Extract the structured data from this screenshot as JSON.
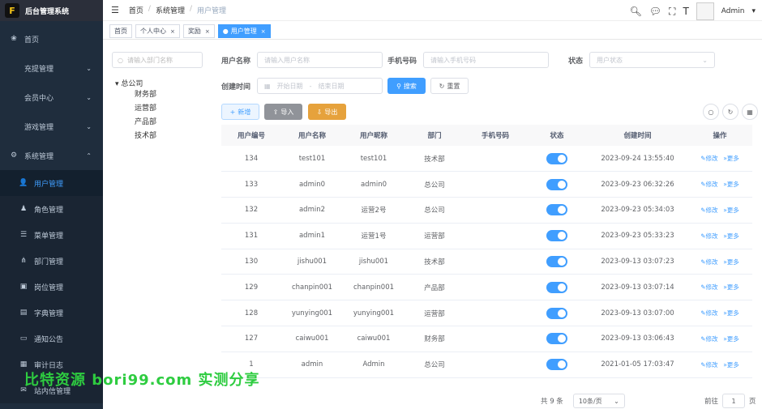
{
  "app": {
    "title": "后台管理系统",
    "logo_text": "F"
  },
  "sidebar": {
    "items": [
      {
        "label": "首页",
        "icon": "dashboard-icon"
      },
      {
        "label": "充提管理",
        "icon": ""
      },
      {
        "label": "会员中心",
        "icon": ""
      },
      {
        "label": "游戏管理",
        "icon": ""
      },
      {
        "label": "系统管理",
        "icon": "gear-icon"
      }
    ],
    "sub_items": [
      {
        "label": "用户管理",
        "icon": "user-icon",
        "active": true
      },
      {
        "label": "角色管理",
        "icon": "peoples-icon"
      },
      {
        "label": "菜单管理",
        "icon": "tree-table-icon"
      },
      {
        "label": "部门管理",
        "icon": "tree-icon"
      },
      {
        "label": "岗位管理",
        "icon": "post-icon"
      },
      {
        "label": "字典管理",
        "icon": "dict-icon"
      },
      {
        "label": "通知公告",
        "icon": "message-icon"
      },
      {
        "label": "审计日志",
        "icon": "log-icon"
      },
      {
        "label": "站内信管理",
        "icon": "mail-icon"
      }
    ]
  },
  "header": {
    "breadcrumb": [
      "首页",
      "系统管理",
      "用户管理"
    ],
    "username": "Admin"
  },
  "tags": [
    {
      "label": "首页",
      "closable": false,
      "active": false
    },
    {
      "label": "个人中心",
      "closable": true,
      "active": false
    },
    {
      "label": "奖励",
      "closable": true,
      "active": false
    },
    {
      "label": "用户管理",
      "closable": true,
      "active": true
    }
  ],
  "tree": {
    "search_placeholder": "请输入部门名称",
    "root": "总公司",
    "children": [
      "财务部",
      "运营部",
      "产品部",
      "技术部"
    ]
  },
  "form": {
    "username_label": "用户名称",
    "username_placeholder": "请输入用户名称",
    "phone_label": "手机号码",
    "phone_placeholder": "请输入手机号码",
    "status_label": "状态",
    "status_placeholder": "用户状态",
    "created_label": "创建时间",
    "start_placeholder": "开始日期",
    "range_sep": "-",
    "end_placeholder": "结束日期",
    "search_button": "搜索",
    "reset_button": "重置"
  },
  "toolbar": {
    "add": "新增",
    "import": "导入",
    "export": "导出"
  },
  "table": {
    "headers": [
      "用户编号",
      "用户名称",
      "用户昵称",
      "部门",
      "手机号码",
      "状态",
      "创建时间",
      "操作"
    ],
    "rows": [
      {
        "id": "134",
        "username": "test101",
        "nickname": "test101",
        "dept": "技术部",
        "phone": "",
        "created": "2023-09-24 13:55:40"
      },
      {
        "id": "133",
        "username": "admin0",
        "nickname": "admin0",
        "dept": "总公司",
        "phone": "",
        "created": "2023-09-23 06:32:26"
      },
      {
        "id": "132",
        "username": "admin2",
        "nickname": "运营2号",
        "dept": "总公司",
        "phone": "",
        "created": "2023-09-23 05:34:03"
      },
      {
        "id": "131",
        "username": "admin1",
        "nickname": "运营1号",
        "dept": "运营部",
        "phone": "",
        "created": "2023-09-23 05:33:23"
      },
      {
        "id": "130",
        "username": "jishu001",
        "nickname": "jishu001",
        "dept": "技术部",
        "phone": "",
        "created": "2023-09-13 03:07:23"
      },
      {
        "id": "129",
        "username": "chanpin001",
        "nickname": "chanpin001",
        "dept": "产品部",
        "phone": "",
        "created": "2023-09-13 03:07:14"
      },
      {
        "id": "128",
        "username": "yunying001",
        "nickname": "yunying001",
        "dept": "运营部",
        "phone": "",
        "created": "2023-09-13 03:07:00"
      },
      {
        "id": "127",
        "username": "caiwu001",
        "nickname": "caiwu001",
        "dept": "财务部",
        "phone": "",
        "created": "2023-09-13 03:06:43"
      },
      {
        "id": "1",
        "username": "admin",
        "nickname": "Admin",
        "dept": "总公司",
        "phone": "",
        "created": "2021-01-05 17:03:47"
      }
    ],
    "edit_label": "修改",
    "more_label": "更多"
  },
  "pagination": {
    "total": "共 9 条",
    "page_size": "10条/页",
    "goto_label": "前往",
    "page": "1",
    "page_suffix": "页"
  },
  "watermark": "比特资源 bori99.com 实测分享",
  "colors": {
    "primary": "#409eff",
    "sidebar_bg": "#1f2d3d",
    "warning": "#e6a23c",
    "info": "#909399"
  }
}
